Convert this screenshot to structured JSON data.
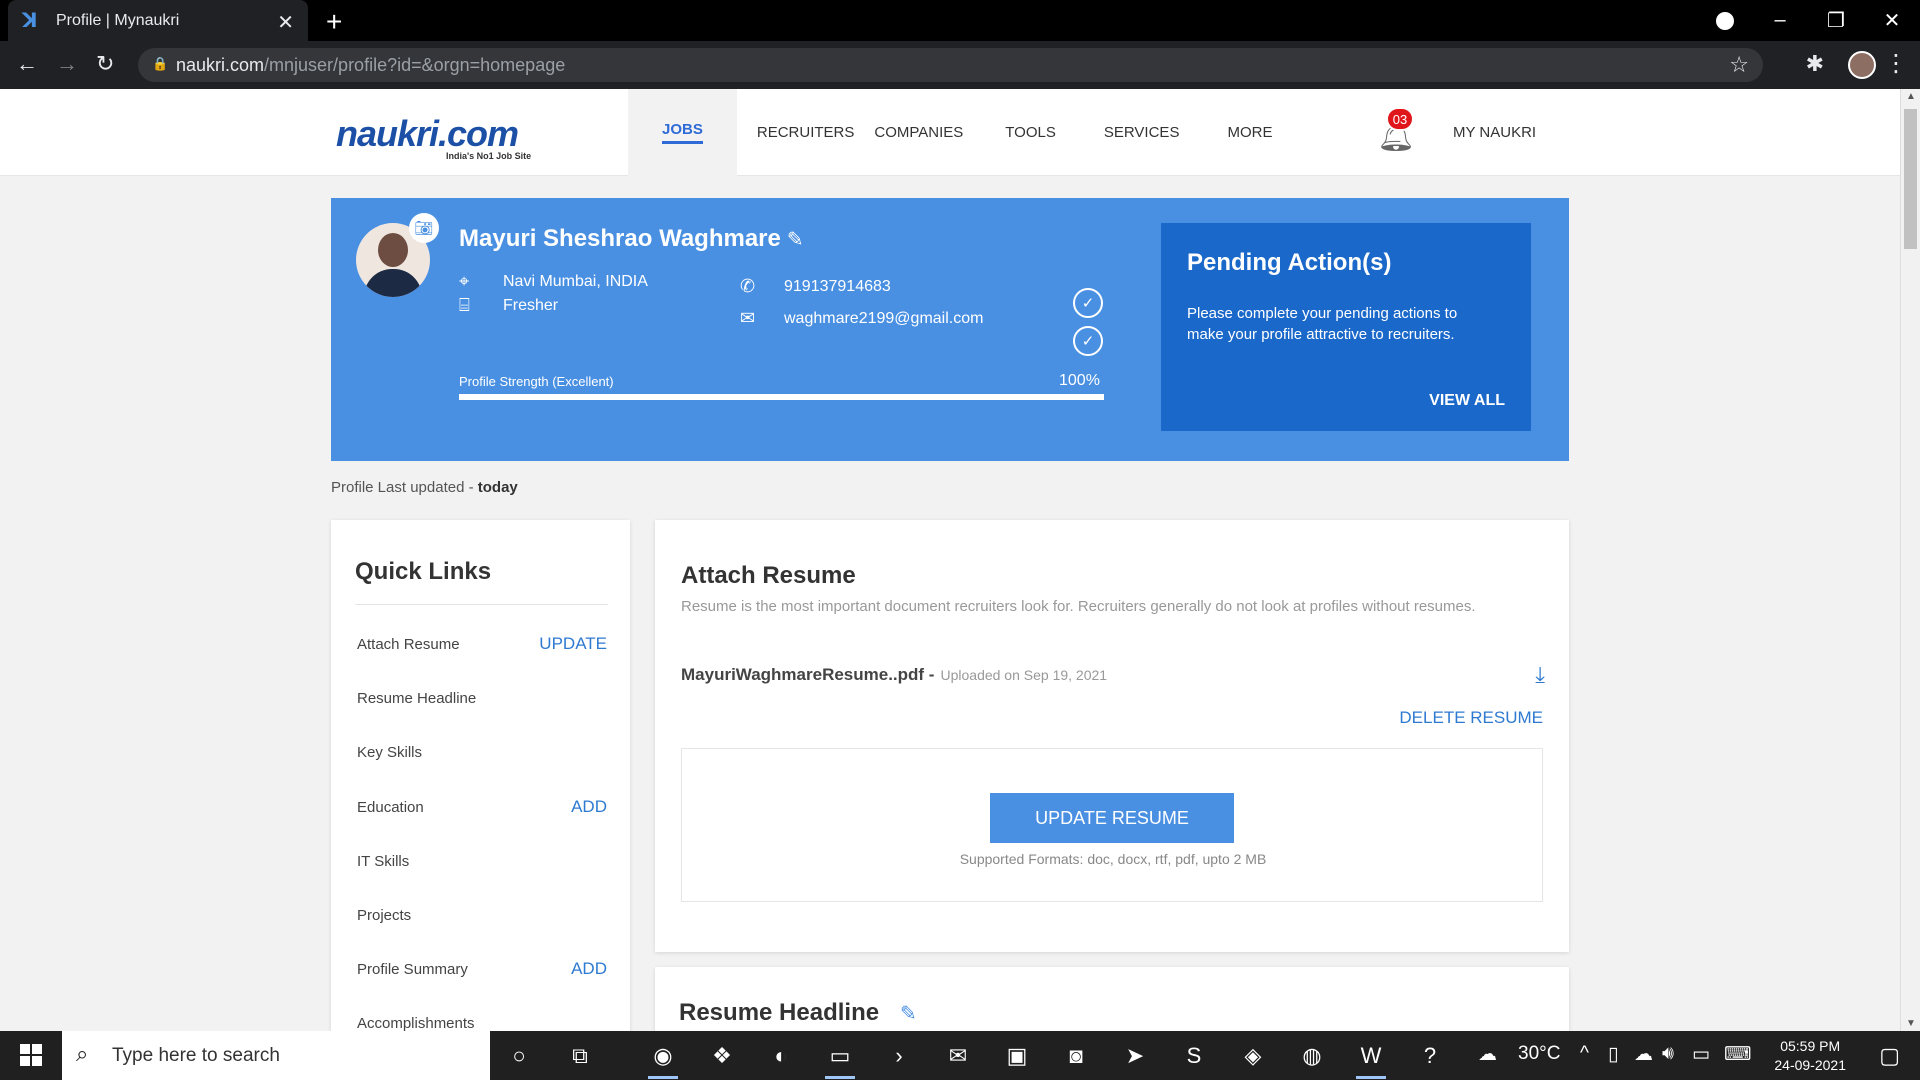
{
  "browser": {
    "tab_title": "Profile | Mynaukri",
    "tab_close": "✕",
    "new_tab": "+",
    "url_host": "naukri.com",
    "url_path": "/mnjuser/profile?id=&orgn=homepage"
  },
  "header": {
    "logo_text": "naukri.com",
    "logo_tagline": "India's No1 Job Site",
    "menu": [
      "JOBS",
      "RECRUITERS",
      "COMPANIES",
      "TOOLS",
      "SERVICES",
      "MORE"
    ],
    "notification_count": "03",
    "my_naukri": "MY NAUKRI"
  },
  "profile": {
    "name": "Mayuri Sheshrao Waghmare",
    "location": "Navi Mumbai, INDIA",
    "experience": "Fresher",
    "phone": "919137914683",
    "email": "waghmare2199@gmail.com",
    "strength_label": "Profile Strength (Excellent)",
    "strength_pct": "100%",
    "strength_value": 1.0
  },
  "pending": {
    "title": "Pending Action(s)",
    "text": "Please complete your pending actions to make your profile attractive to recruiters.",
    "link": "VIEW ALL"
  },
  "last_updated": {
    "label": "Profile Last updated - ",
    "value": "today"
  },
  "quick_links": {
    "title": "Quick Links",
    "items": [
      {
        "label": "Attach Resume",
        "action": "UPDATE"
      },
      {
        "label": "Resume Headline",
        "action": ""
      },
      {
        "label": "Key Skills",
        "action": ""
      },
      {
        "label": "Education",
        "action": "ADD"
      },
      {
        "label": "IT Skills",
        "action": ""
      },
      {
        "label": "Projects",
        "action": ""
      },
      {
        "label": "Profile Summary",
        "action": "ADD"
      },
      {
        "label": "Accomplishments",
        "action": ""
      }
    ]
  },
  "resume": {
    "title": "Attach Resume",
    "description": "Resume is the most important document recruiters look for. Recruiters generally do not look at profiles without resumes.",
    "file_name": "MayuriWaghmareResume..pdf -",
    "uploaded": "Uploaded on Sep 19, 2021",
    "delete": "DELETE RESUME",
    "update_button": "UPDATE RESUME",
    "formats": "Supported Formats: doc, docx, rtf, pdf, upto 2 MB"
  },
  "headline": {
    "title": "Resume Headline"
  },
  "taskbar": {
    "search_placeholder": "Type here to search",
    "weather": "30°C",
    "time": "05:59 PM",
    "date": "24-09-2021"
  },
  "colors": {
    "brand_blue": "#4a90e2",
    "pending_blue": "#1a68c9",
    "link_blue": "#2e7ad1",
    "badge_red": "#e0161b"
  }
}
